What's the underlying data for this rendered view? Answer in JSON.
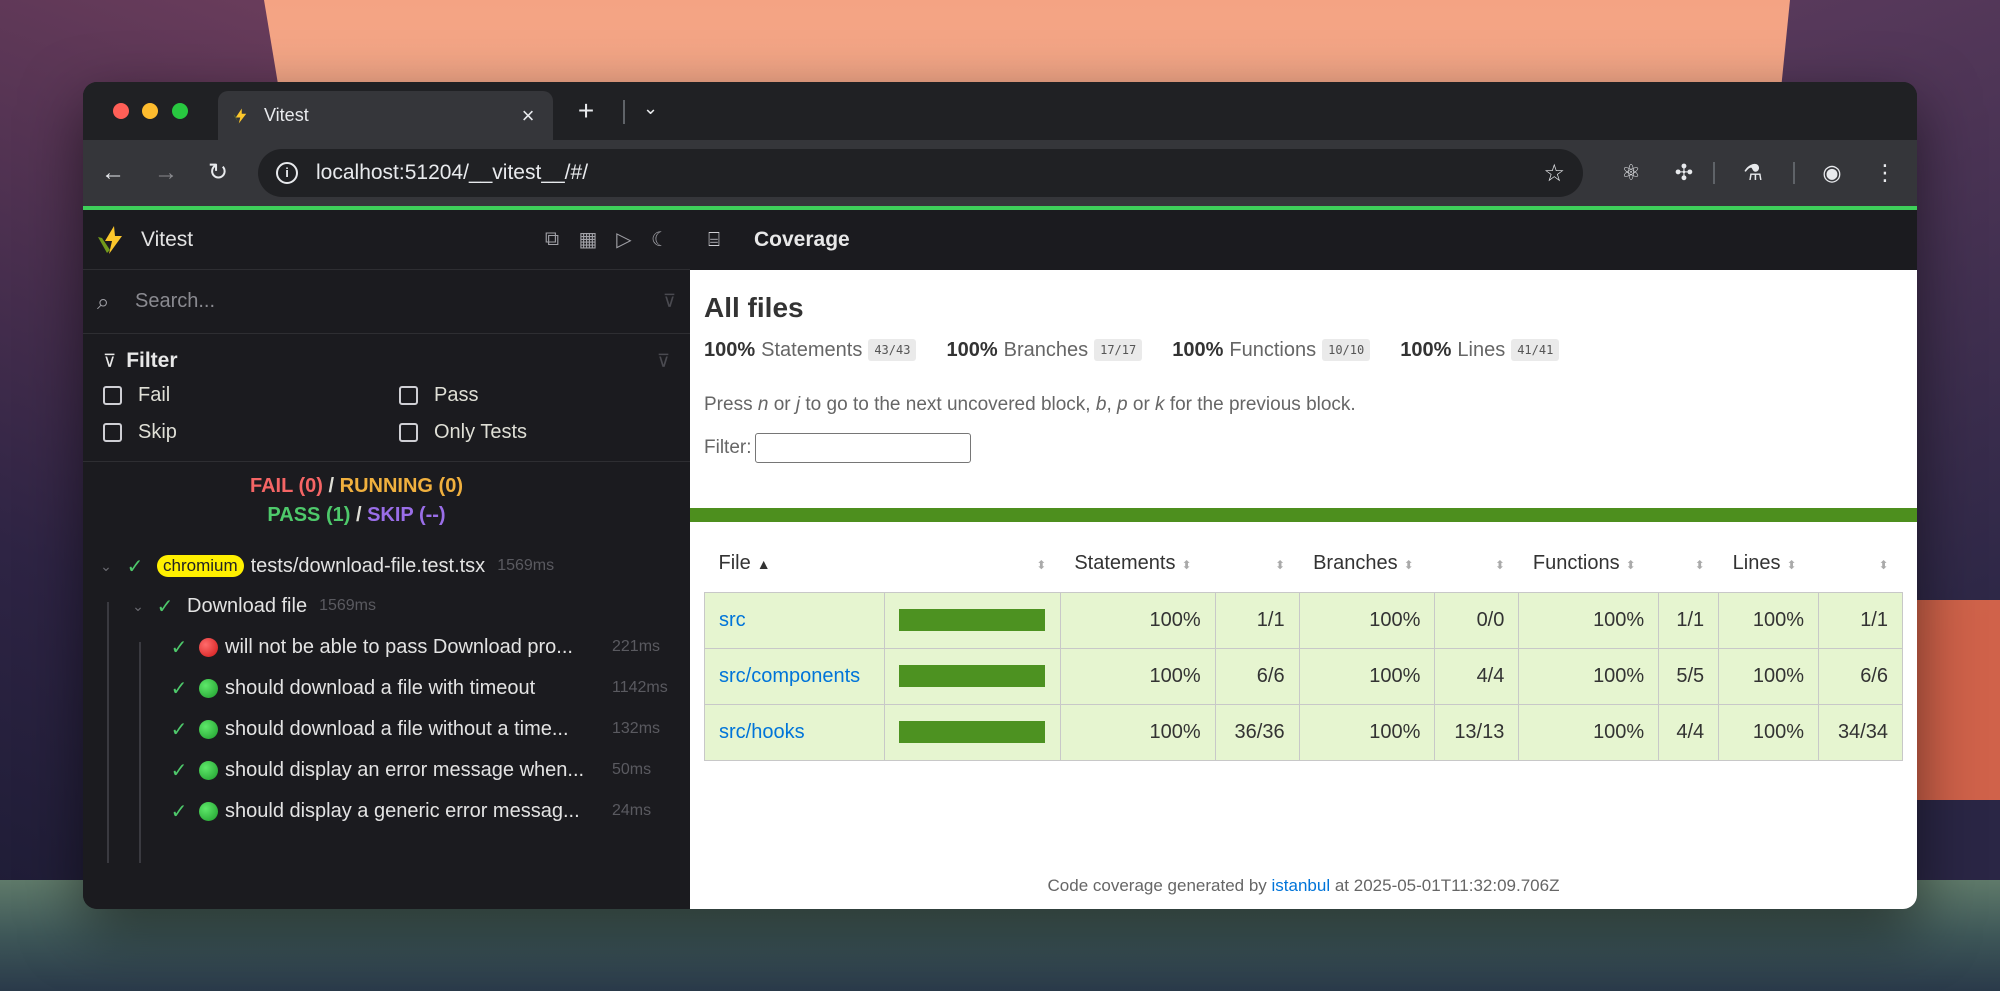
{
  "browser": {
    "tab_title": "Vitest",
    "url": "localhost:51204/__vitest__/#/",
    "accent_color": "#3ecf5a"
  },
  "vitest": {
    "title": "Vitest",
    "search_placeholder": "Search...",
    "filter": {
      "title": "Filter",
      "options": [
        "Fail",
        "Pass",
        "Skip",
        "Only Tests"
      ]
    },
    "summary": {
      "fail": "FAIL (0)",
      "running": "RUNNING (0)",
      "pass": "PASS (1)",
      "skip": "SKIP (--)"
    },
    "tree": {
      "file": {
        "badge": "chromium",
        "name": "tests/download-file.test.tsx",
        "duration": "1569ms"
      },
      "suite": {
        "name": "Download file",
        "duration": "1569ms"
      },
      "tests": [
        {
          "status": "fail",
          "name": "will not be able to pass Download pro...",
          "duration": "221ms"
        },
        {
          "status": "pass",
          "name": "should download a file with timeout",
          "duration": "1142ms"
        },
        {
          "status": "pass",
          "name": "should download a file without a time...",
          "duration": "132ms"
        },
        {
          "status": "pass",
          "name": "should display an error message when...",
          "duration": "50ms"
        },
        {
          "status": "pass",
          "name": "should display a generic error messag...",
          "duration": "24ms"
        }
      ]
    }
  },
  "coverage": {
    "panel_title": "Coverage",
    "heading": "All files",
    "stats": [
      {
        "pct": "100%",
        "label": "Statements",
        "frac": "43/43"
      },
      {
        "pct": "100%",
        "label": "Branches",
        "frac": "17/17"
      },
      {
        "pct": "100%",
        "label": "Functions",
        "frac": "10/10"
      },
      {
        "pct": "100%",
        "label": "Lines",
        "frac": "41/41"
      }
    ],
    "help": {
      "t1": "Press ",
      "k1": "n",
      "t2": " or ",
      "k2": "j",
      "t3": " to go to the next uncovered block, ",
      "k3": "b",
      "t4": ", ",
      "k4": "p",
      "t5": " or ",
      "k5": "k",
      "t6": " for the previous block."
    },
    "filter_label": "Filter:",
    "columns": [
      "File",
      "Statements",
      "Branches",
      "Functions",
      "Lines"
    ],
    "rows": [
      {
        "file": "src",
        "coverage": 1.0,
        "stmt_pct": "100%",
        "stmt": "1/1",
        "br_pct": "100%",
        "br": "0/0",
        "fn_pct": "100%",
        "fn": "1/1",
        "ln_pct": "100%",
        "ln": "1/1"
      },
      {
        "file": "src/components",
        "coverage": 1.0,
        "stmt_pct": "100%",
        "stmt": "6/6",
        "br_pct": "100%",
        "br": "4/4",
        "fn_pct": "100%",
        "fn": "5/5",
        "ln_pct": "100%",
        "ln": "6/6"
      },
      {
        "file": "src/hooks",
        "coverage": 1.0,
        "stmt_pct": "100%",
        "stmt": "36/36",
        "br_pct": "100%",
        "br": "13/13",
        "fn_pct": "100%",
        "fn": "4/4",
        "ln_pct": "100%",
        "ln": "34/34"
      }
    ],
    "footer": {
      "prefix": "Code coverage generated by ",
      "link": "istanbul",
      "suffix": " at 2025-05-01T11:32:09.706Z"
    }
  }
}
